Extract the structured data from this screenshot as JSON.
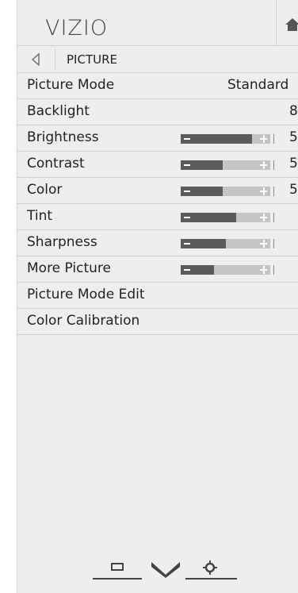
{
  "header": {
    "logo": "VIZIO",
    "home_icon": "home-icon"
  },
  "breadcrumb": {
    "back_icon": "back-arrow-icon",
    "label": "PICTURE"
  },
  "menu": [
    {
      "label": "Picture Mode",
      "value": "Standard"
    },
    {
      "label": "Backlight",
      "value": "8"
    },
    {
      "label": "Brightness",
      "value": "5",
      "slider": 0.8
    },
    {
      "label": "Contrast",
      "value": "5",
      "slider": 0.47
    },
    {
      "label": "Color",
      "value": "5",
      "slider": 0.47
    },
    {
      "label": "Tint",
      "slider": 0.62
    },
    {
      "label": "Sharpness",
      "slider": 0.5
    },
    {
      "label": "More Picture",
      "slider": 0.37
    },
    {
      "label": "Picture Mode Edit"
    },
    {
      "label": "Color Calibration"
    }
  ],
  "bottom_bar": {
    "icons": [
      "wide-screen-icon",
      "chevron-down-icon",
      "gear-icon"
    ]
  },
  "colors": {
    "panel_bg": "#eeeeee",
    "slider_fill": "#5b5b5b",
    "slider_track": "#c4c4c4",
    "text": "#222222"
  }
}
